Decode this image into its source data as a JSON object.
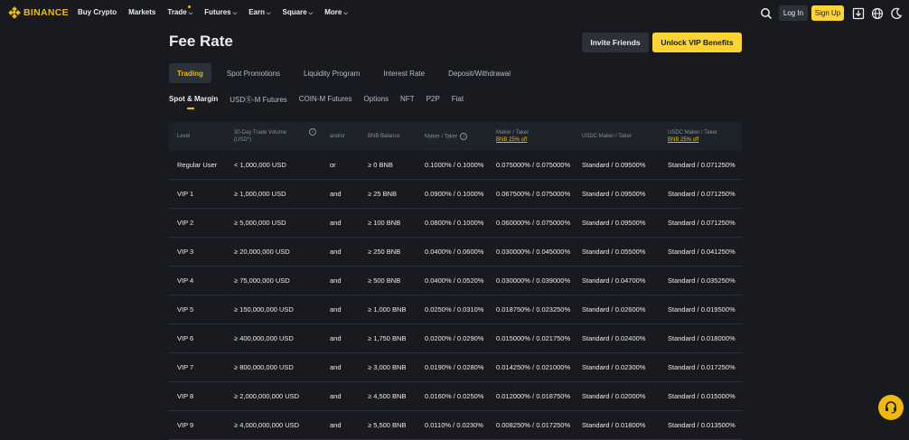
{
  "brand": {
    "name": "BINANCE",
    "color": "#f0b90b"
  },
  "nav": {
    "items": [
      {
        "label": "Buy Crypto",
        "chevron": false
      },
      {
        "label": "Markets",
        "chevron": false
      },
      {
        "label": "Trade",
        "chevron": true
      },
      {
        "label": "Futures",
        "chevron": true
      },
      {
        "label": "Earn",
        "chevron": true
      },
      {
        "label": "Square",
        "chevron": true
      },
      {
        "label": "More",
        "chevron": true
      }
    ],
    "login_label": "Log In",
    "signup_label": "Sign Up",
    "icons": [
      "search-icon",
      "download-icon",
      "globe-icon",
      "theme-toggle-icon"
    ]
  },
  "page": {
    "title": "Fee Rate",
    "invite_label": "Invite Friends",
    "vip_label": "Unlock VIP Benefits"
  },
  "tabs_primary": [
    "Trading",
    "Spot Promotions",
    "Liquidity Program",
    "Interest Rate",
    "Deposit/Withdrawal"
  ],
  "tabs_secondary": [
    "Spot & Margin",
    "USDⓈ-M Futures",
    "COIN-M Futures",
    "Options",
    "NFT",
    "P2P",
    "Fiat"
  ],
  "table": {
    "headers": {
      "level": "Level",
      "volume": [
        "30-Day Trade Volume",
        "(USD*)"
      ],
      "andor": "and/or",
      "bnb": "BNB Balance",
      "maker_taker": "Maker / Taker",
      "maker_taker_bnb": [
        "Maker / Taker",
        "BNB 25% off"
      ],
      "usdc": "USDC Maker / Taker",
      "usdc_bnb": [
        "USDC Maker / Taker",
        "BNB 25% off"
      ]
    },
    "rows": [
      [
        "Regular User",
        "< 1,000,000 USD",
        "or",
        "≥ 0 BNB",
        "0.1000% / 0.1000%",
        "0.075000% / 0.075000%",
        "Standard / 0.09500%",
        "Standard / 0.071250%"
      ],
      [
        "VIP 1",
        "≥ 1,000,000 USD",
        "and",
        "≥ 25 BNB",
        "0.0900% / 0.1000%",
        "0.067500% / 0.075000%",
        "Standard / 0.09500%",
        "Standard / 0.071250%"
      ],
      [
        "VIP 2",
        "≥ 5,000,000 USD",
        "and",
        "≥ 100 BNB",
        "0.0800% / 0.1000%",
        "0.060000% / 0.075000%",
        "Standard / 0.09500%",
        "Standard / 0.071250%"
      ],
      [
        "VIP 3",
        "≥ 20,000,000 USD",
        "and",
        "≥ 250 BNB",
        "0.0400% / 0.0600%",
        "0.030000% / 0.045000%",
        "Standard / 0.05500%",
        "Standard / 0.041250%"
      ],
      [
        "VIP 4",
        "≥ 75,000,000 USD",
        "and",
        "≥ 500 BNB",
        "0.0400% / 0.0520%",
        "0.030000% / 0.039000%",
        "Standard / 0.04700%",
        "Standard / 0.035250%"
      ],
      [
        "VIP 5",
        "≥ 150,000,000 USD",
        "and",
        "≥ 1,000 BNB",
        "0.0250% / 0.0310%",
        "0.018750% / 0.023250%",
        "Standard / 0.02600%",
        "Standard / 0.019500%"
      ],
      [
        "VIP 6",
        "≥ 400,000,000 USD",
        "and",
        "≥ 1,750 BNB",
        "0.0200% / 0.0290%",
        "0.015000% / 0.021750%",
        "Standard / 0.02400%",
        "Standard / 0.018000%"
      ],
      [
        "VIP 7",
        "≥ 800,000,000 USD",
        "and",
        "≥ 3,000 BNB",
        "0.0190% / 0.0280%",
        "0.014250% / 0.021000%",
        "Standard / 0.02300%",
        "Standard / 0.017250%"
      ],
      [
        "VIP 8",
        "≥ 2,000,000,000 USD",
        "and",
        "≥ 4,500 BNB",
        "0.0160% / 0.0250%",
        "0.012000% / 0.018750%",
        "Standard / 0.02000%",
        "Standard / 0.015000%"
      ],
      [
        "VIP 9",
        "≥ 4,000,000,000 USD",
        "and",
        "≥ 5,500 BNB",
        "0.0110% / 0.0230%",
        "0.008250% / 0.017250%",
        "Standard / 0.01800%",
        "Standard / 0.013500%"
      ]
    ]
  },
  "colors": {
    "accent": "#f0b90b",
    "button_yellow": "#fcd535",
    "bg": "#181a20",
    "panel": "#1e2329"
  }
}
